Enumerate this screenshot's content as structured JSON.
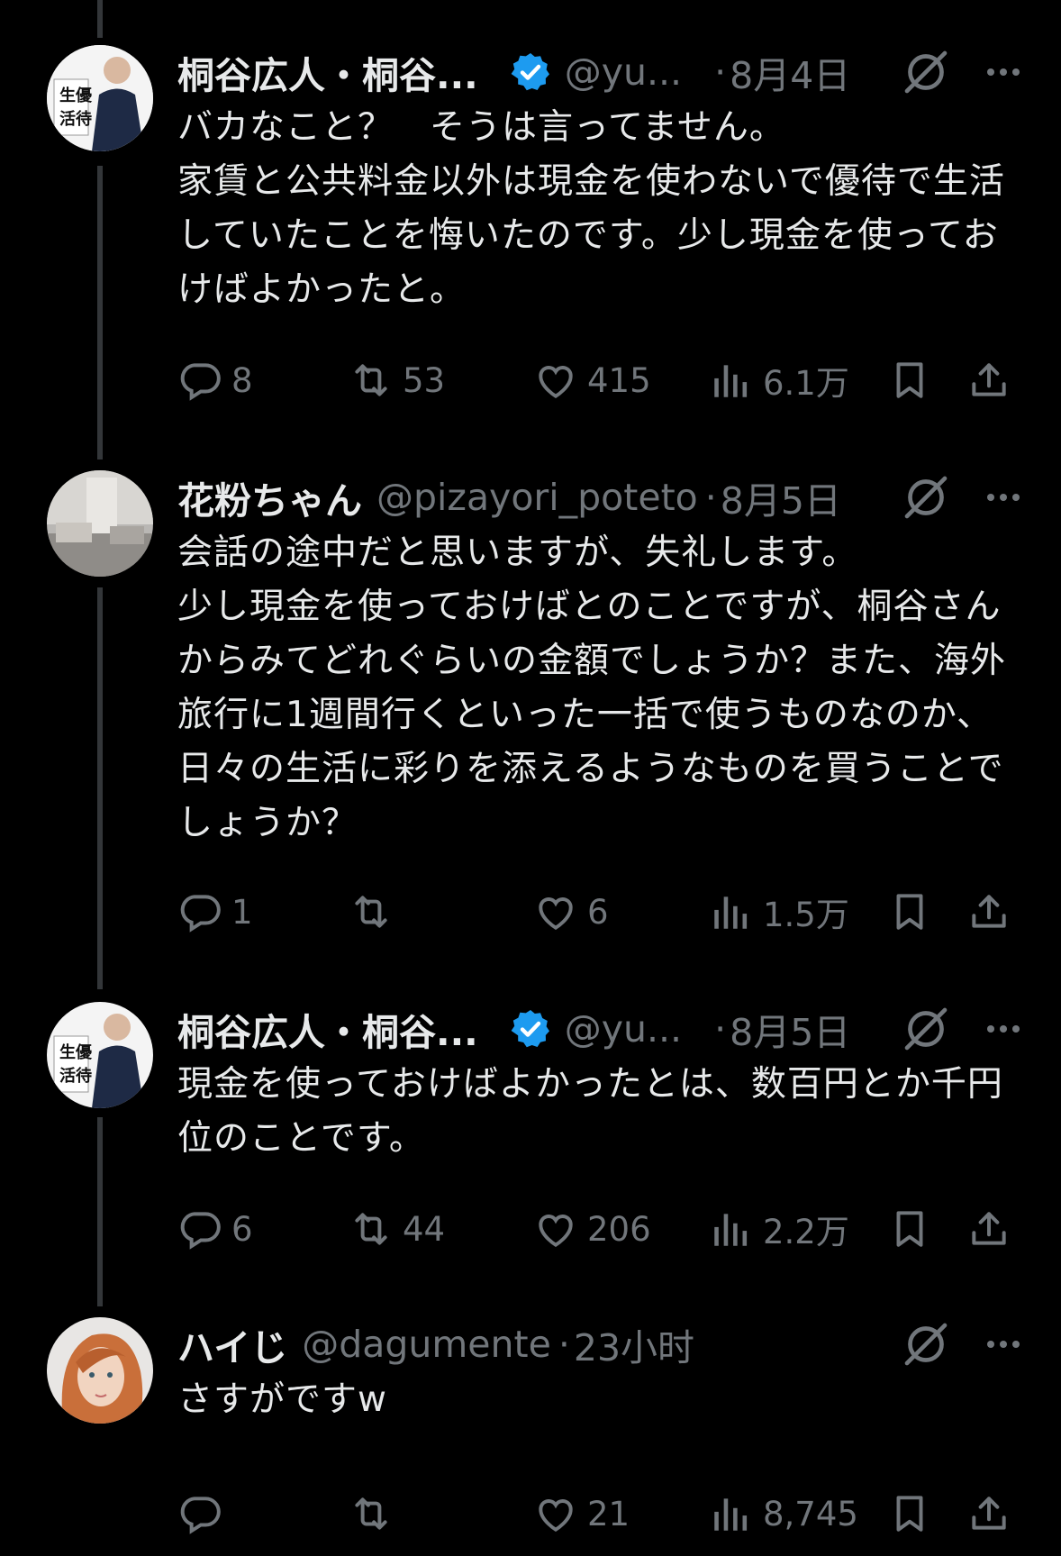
{
  "tweets": [
    {
      "name": "桐谷広人・桐谷...",
      "verified": true,
      "handle": "@yu...",
      "dot": "·",
      "date": "8月4日",
      "text": "バカなこと？　そうは言ってません。\n家賃と公共料金以外は現金を使わないで優待で生活していたことを悔いたのです。少し現金を使っておけばよかったと。",
      "replies": "8",
      "retweets": "53",
      "likes": "415",
      "views": "6.1万",
      "avatar_text": "生優\n活待"
    },
    {
      "name": "花粉ちゃん",
      "verified": false,
      "handle": "@pizayori_poteto",
      "dot": "·",
      "date": "8月5日",
      "text": "会話の途中だと思いますが、失礼します。\n少し現金を使っておけばとのことですが、桐谷さんからみてどれぐらいの金額でしょうか？また、海外旅行に1週間行くといった一括で使うものなのか、日々の生活に彩りを添えるようなものを買うことでしょうか？",
      "replies": "1",
      "retweets": "",
      "likes": "6",
      "views": "1.5万"
    },
    {
      "name": "桐谷広人・桐谷...",
      "verified": true,
      "handle": "@yu...",
      "dot": "·",
      "date": "8月5日",
      "text": "現金を使っておけばよかったとは、数百円とか千円位のことです。",
      "replies": "6",
      "retweets": "44",
      "likes": "206",
      "views": "2.2万",
      "avatar_text": "生優\n活待"
    },
    {
      "name": "ハイじ",
      "verified": false,
      "handle": "@dagumente",
      "dot": "·",
      "date": "23小时",
      "text": "さすがですw",
      "replies": "",
      "retweets": "",
      "likes": "21",
      "views": "8,745"
    }
  ],
  "icons": {
    "reply": "reply-icon",
    "retweet": "retweet-icon",
    "like": "heart-icon",
    "views": "views-icon",
    "bookmark": "bookmark-icon",
    "share": "share-icon",
    "grok": "grok-icon",
    "more": "more-icon",
    "verified": "verified-badge-icon"
  },
  "colors": {
    "background": "#000000",
    "text": "#e7e9ea",
    "muted": "#71767b",
    "verified": "#1d9bf0",
    "thread_line": "#333639"
  }
}
